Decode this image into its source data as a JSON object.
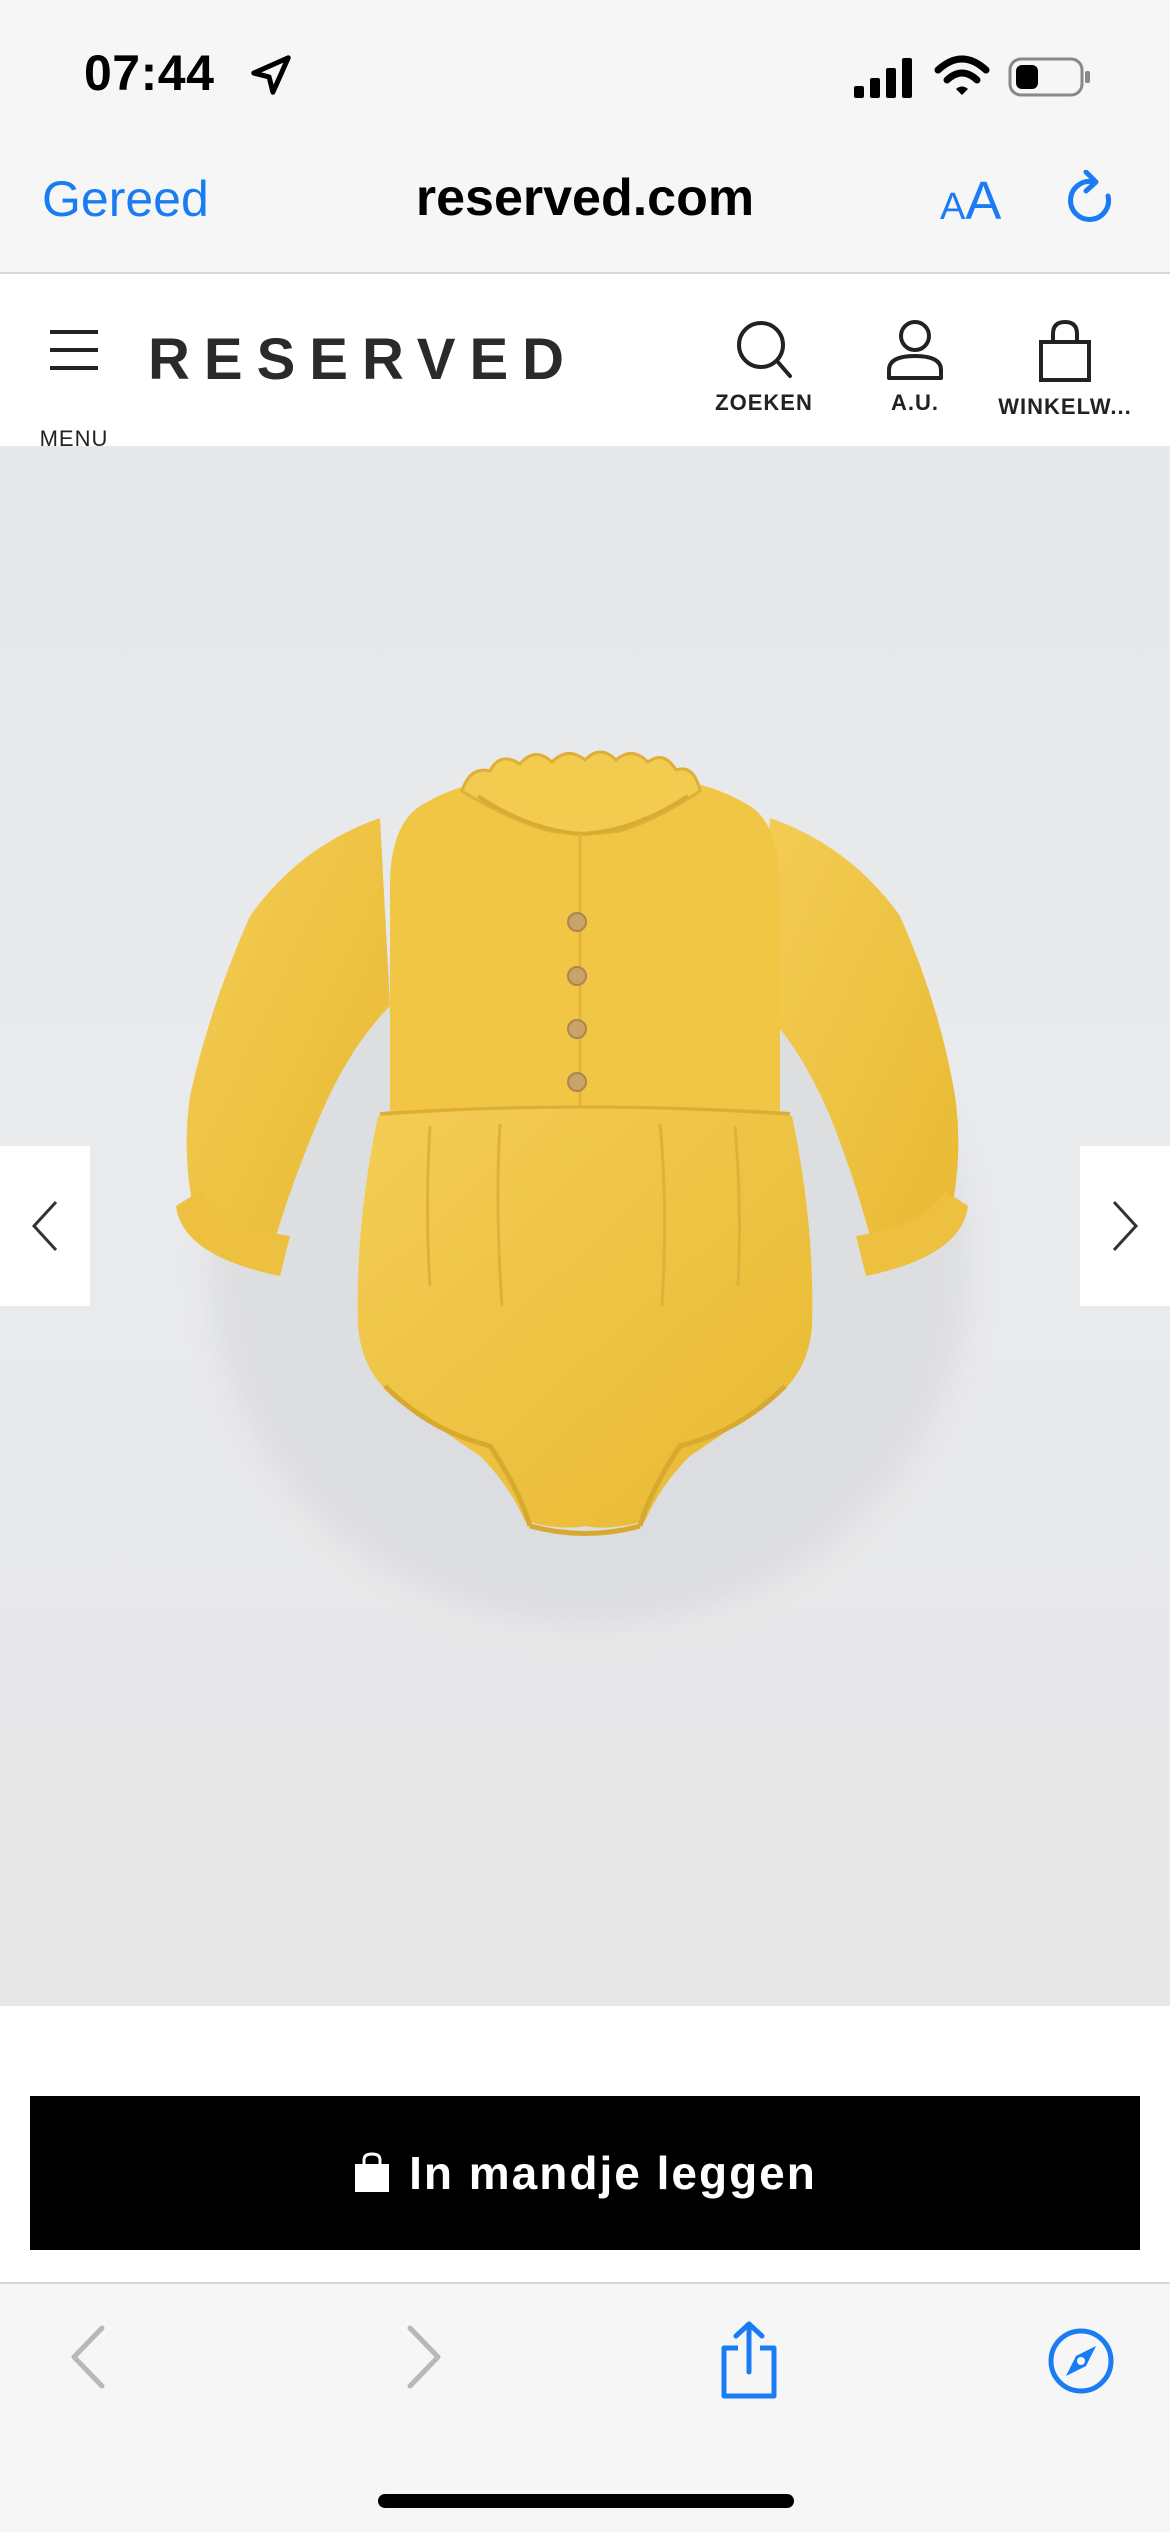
{
  "status_bar": {
    "time": "07:44"
  },
  "browser": {
    "done_label": "Gereed",
    "domain": "reserved.com",
    "text_size_label_small": "A",
    "text_size_label_big": "A"
  },
  "site_header": {
    "menu_label": "MENU",
    "logo_text": "RESERVED",
    "search_label": "ZOEKEN",
    "account_label": "A.U.",
    "cart_label": "WINKELW..."
  },
  "product": {
    "image_alt_name": "yellow baby romper with ruffled collar and wooden buttons",
    "colors": {
      "garment": "#f0c443",
      "background": "#e8e9eb"
    }
  },
  "actions": {
    "add_to_cart_label": "In mandje leggen"
  },
  "colors": {
    "accent": "#1a7cf2",
    "button_bg": "#000000"
  }
}
